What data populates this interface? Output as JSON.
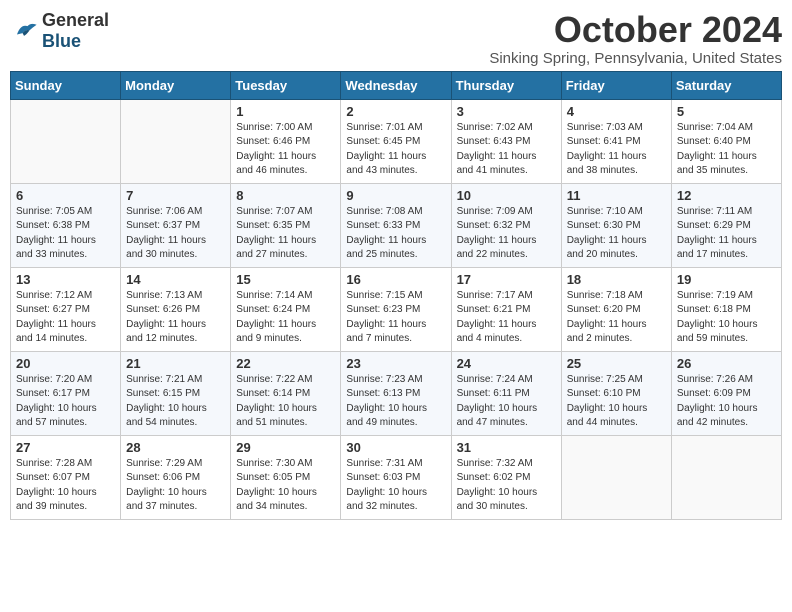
{
  "header": {
    "logo_general": "General",
    "logo_blue": "Blue",
    "month": "October 2024",
    "location": "Sinking Spring, Pennsylvania, United States"
  },
  "weekdays": [
    "Sunday",
    "Monday",
    "Tuesday",
    "Wednesday",
    "Thursday",
    "Friday",
    "Saturday"
  ],
  "weeks": [
    [
      {
        "day": "",
        "info": ""
      },
      {
        "day": "",
        "info": ""
      },
      {
        "day": "1",
        "info": "Sunrise: 7:00 AM\nSunset: 6:46 PM\nDaylight: 11 hours and 46 minutes."
      },
      {
        "day": "2",
        "info": "Sunrise: 7:01 AM\nSunset: 6:45 PM\nDaylight: 11 hours and 43 minutes."
      },
      {
        "day": "3",
        "info": "Sunrise: 7:02 AM\nSunset: 6:43 PM\nDaylight: 11 hours and 41 minutes."
      },
      {
        "day": "4",
        "info": "Sunrise: 7:03 AM\nSunset: 6:41 PM\nDaylight: 11 hours and 38 minutes."
      },
      {
        "day": "5",
        "info": "Sunrise: 7:04 AM\nSunset: 6:40 PM\nDaylight: 11 hours and 35 minutes."
      }
    ],
    [
      {
        "day": "6",
        "info": "Sunrise: 7:05 AM\nSunset: 6:38 PM\nDaylight: 11 hours and 33 minutes."
      },
      {
        "day": "7",
        "info": "Sunrise: 7:06 AM\nSunset: 6:37 PM\nDaylight: 11 hours and 30 minutes."
      },
      {
        "day": "8",
        "info": "Sunrise: 7:07 AM\nSunset: 6:35 PM\nDaylight: 11 hours and 27 minutes."
      },
      {
        "day": "9",
        "info": "Sunrise: 7:08 AM\nSunset: 6:33 PM\nDaylight: 11 hours and 25 minutes."
      },
      {
        "day": "10",
        "info": "Sunrise: 7:09 AM\nSunset: 6:32 PM\nDaylight: 11 hours and 22 minutes."
      },
      {
        "day": "11",
        "info": "Sunrise: 7:10 AM\nSunset: 6:30 PM\nDaylight: 11 hours and 20 minutes."
      },
      {
        "day": "12",
        "info": "Sunrise: 7:11 AM\nSunset: 6:29 PM\nDaylight: 11 hours and 17 minutes."
      }
    ],
    [
      {
        "day": "13",
        "info": "Sunrise: 7:12 AM\nSunset: 6:27 PM\nDaylight: 11 hours and 14 minutes."
      },
      {
        "day": "14",
        "info": "Sunrise: 7:13 AM\nSunset: 6:26 PM\nDaylight: 11 hours and 12 minutes."
      },
      {
        "day": "15",
        "info": "Sunrise: 7:14 AM\nSunset: 6:24 PM\nDaylight: 11 hours and 9 minutes."
      },
      {
        "day": "16",
        "info": "Sunrise: 7:15 AM\nSunset: 6:23 PM\nDaylight: 11 hours and 7 minutes."
      },
      {
        "day": "17",
        "info": "Sunrise: 7:17 AM\nSunset: 6:21 PM\nDaylight: 11 hours and 4 minutes."
      },
      {
        "day": "18",
        "info": "Sunrise: 7:18 AM\nSunset: 6:20 PM\nDaylight: 11 hours and 2 minutes."
      },
      {
        "day": "19",
        "info": "Sunrise: 7:19 AM\nSunset: 6:18 PM\nDaylight: 10 hours and 59 minutes."
      }
    ],
    [
      {
        "day": "20",
        "info": "Sunrise: 7:20 AM\nSunset: 6:17 PM\nDaylight: 10 hours and 57 minutes."
      },
      {
        "day": "21",
        "info": "Sunrise: 7:21 AM\nSunset: 6:15 PM\nDaylight: 10 hours and 54 minutes."
      },
      {
        "day": "22",
        "info": "Sunrise: 7:22 AM\nSunset: 6:14 PM\nDaylight: 10 hours and 51 minutes."
      },
      {
        "day": "23",
        "info": "Sunrise: 7:23 AM\nSunset: 6:13 PM\nDaylight: 10 hours and 49 minutes."
      },
      {
        "day": "24",
        "info": "Sunrise: 7:24 AM\nSunset: 6:11 PM\nDaylight: 10 hours and 47 minutes."
      },
      {
        "day": "25",
        "info": "Sunrise: 7:25 AM\nSunset: 6:10 PM\nDaylight: 10 hours and 44 minutes."
      },
      {
        "day": "26",
        "info": "Sunrise: 7:26 AM\nSunset: 6:09 PM\nDaylight: 10 hours and 42 minutes."
      }
    ],
    [
      {
        "day": "27",
        "info": "Sunrise: 7:28 AM\nSunset: 6:07 PM\nDaylight: 10 hours and 39 minutes."
      },
      {
        "day": "28",
        "info": "Sunrise: 7:29 AM\nSunset: 6:06 PM\nDaylight: 10 hours and 37 minutes."
      },
      {
        "day": "29",
        "info": "Sunrise: 7:30 AM\nSunset: 6:05 PM\nDaylight: 10 hours and 34 minutes."
      },
      {
        "day": "30",
        "info": "Sunrise: 7:31 AM\nSunset: 6:03 PM\nDaylight: 10 hours and 32 minutes."
      },
      {
        "day": "31",
        "info": "Sunrise: 7:32 AM\nSunset: 6:02 PM\nDaylight: 10 hours and 30 minutes."
      },
      {
        "day": "",
        "info": ""
      },
      {
        "day": "",
        "info": ""
      }
    ]
  ]
}
